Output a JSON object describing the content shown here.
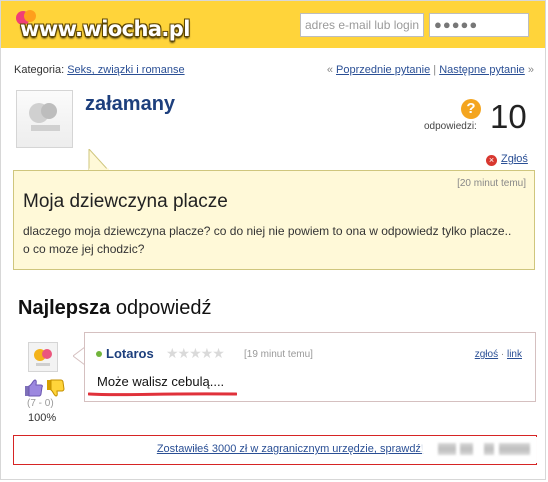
{
  "header": {
    "logo_text": "www.wiocha.pl",
    "email_placeholder": "adres e-mail lub login",
    "password_mask": "●●●●●"
  },
  "breadcrumbs": {
    "category_label": "Kategoria: ",
    "category_link": "Seks, związki i romanse"
  },
  "pager": {
    "prev_prefix": "« ",
    "prev_label": "Poprzednie pytanie",
    "separator": " | ",
    "next_label": "Następne pytanie",
    "next_suffix": " »"
  },
  "question_author": {
    "username": "załamany",
    "answers_label": "odpowiedzi:",
    "answers_count": "10",
    "report_label": "Zgłoś"
  },
  "question": {
    "time": "[20 minut temu]",
    "title": "Moja dziewczyna placze",
    "body": "dlaczego moja dziewczyna placze? co do niej nie powiem to ona w odpowiedz tylko placze.. o co moze jej chodzic?"
  },
  "best_answer": {
    "heading_strong": "Najlepsza",
    "heading_rest": " odpowiedź",
    "username": "Lotaros",
    "time": "[19 minut temu]",
    "report_label": "zgłoś",
    "separator": " · ",
    "link_label": "link",
    "text": "Może walisz cebulą....",
    "votes": "(7 - 0)",
    "percent": "100%"
  },
  "ad": {
    "text": "Zostawiłeś 3000 zł w zagranicznym urzędzie, sprawdź!"
  }
}
